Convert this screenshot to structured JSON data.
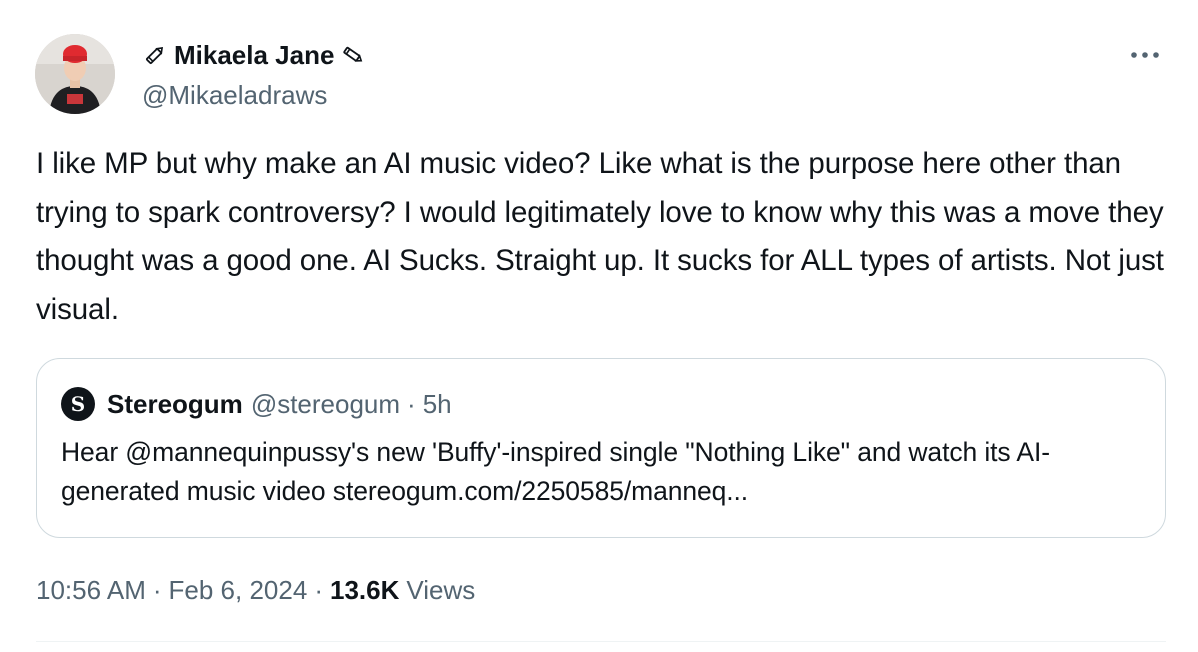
{
  "author": {
    "name": "Mikaela Jane",
    "handle": "@Mikaeladraws",
    "name_prefix_icon": "pencil-icon",
    "name_suffix_icon": "pencil-icon"
  },
  "more_icon": "more-dots-icon",
  "tweet_text": "I like MP but why make an AI music video? Like what is the purpose here other than trying to spark controversy? I would legitimately love to know why this was a move they thought was a good one. AI Sucks. Straight up. It sucks for ALL types of artists. Not just visual.",
  "quote": {
    "avatar_letter": "S",
    "name": "Stereogum",
    "handle": "@stereogum",
    "separator": "·",
    "time": "5h",
    "text": "Hear @mannequinpussy's new 'Buffy'-inspired single \"Nothing Like\" and watch its AI-generated music video stereogum.com/2250585/manneq..."
  },
  "meta": {
    "time": "10:56 AM",
    "dot": "·",
    "date": "Feb 6, 2024",
    "views_count": "13.6K",
    "views_label": "Views"
  },
  "colors": {
    "text": "#0f1419",
    "secondary": "#536471",
    "border": "#cfd9de",
    "background": "#ffffff"
  }
}
